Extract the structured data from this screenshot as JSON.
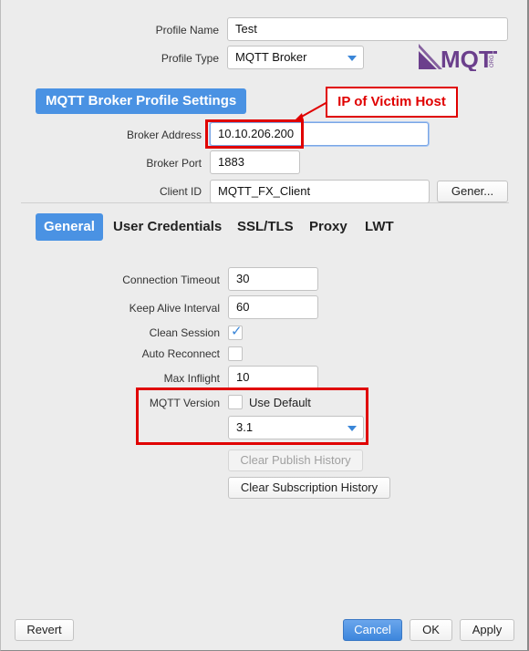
{
  "profile": {
    "name_label": "Profile Name",
    "name_value": "Test",
    "type_label": "Profile Type",
    "type_value": "MQTT Broker",
    "logo_text": "MQTT",
    "logo_sub": "ORG"
  },
  "section_title": "MQTT Broker Profile Settings",
  "annotation": {
    "callout_text": "IP of Victim Host",
    "color": "#e00000"
  },
  "broker": {
    "address_label": "Broker Address",
    "address_value": "10.10.206.200",
    "port_label": "Broker Port",
    "port_value": "1883",
    "client_id_label": "Client ID",
    "client_id_value": "MQTT_FX_Client",
    "generate_label": "Gener..."
  },
  "tabs": [
    {
      "label": "General",
      "active": true
    },
    {
      "label": "User Credentials",
      "active": false
    },
    {
      "label": "SSL/TLS",
      "active": false
    },
    {
      "label": "Proxy",
      "active": false
    },
    {
      "label": "LWT",
      "active": false
    }
  ],
  "general": {
    "connection_timeout_label": "Connection Timeout",
    "connection_timeout_value": "30",
    "keep_alive_label": "Keep Alive Interval",
    "keep_alive_value": "60",
    "clean_session_label": "Clean Session",
    "clean_session_checked": true,
    "auto_reconnect_label": "Auto Reconnect",
    "auto_reconnect_checked": false,
    "max_inflight_label": "Max Inflight",
    "max_inflight_value": "10",
    "mqtt_version_label": "MQTT Version",
    "use_default_label": "Use Default",
    "use_default_checked": false,
    "mqtt_version_value": "3.1",
    "clear_publish_label": "Clear Publish History",
    "clear_subscription_label": "Clear Subscription History"
  },
  "footer": {
    "revert_label": "Revert",
    "cancel_label": "Cancel",
    "ok_label": "OK",
    "apply_label": "Apply"
  },
  "colors": {
    "accent": "#4a92e3",
    "annotation": "#e00000",
    "logo": "#6b3f8c"
  }
}
